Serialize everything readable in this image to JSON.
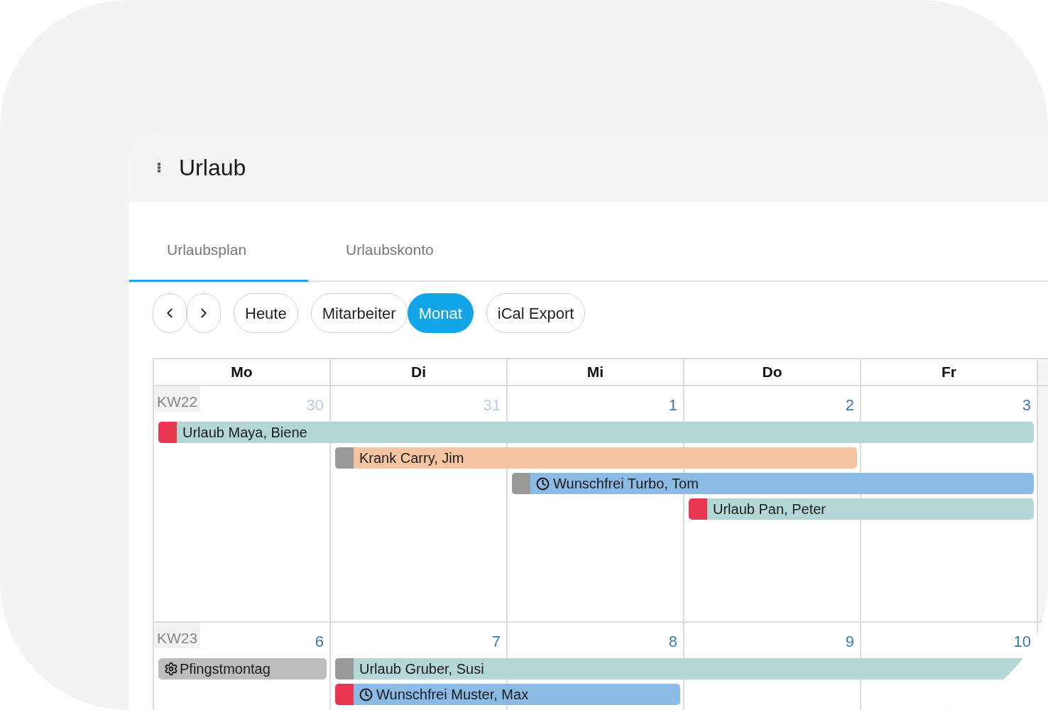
{
  "app": {
    "title": "Urlaub"
  },
  "tabs": [
    {
      "label": "Urlaubsplan",
      "selected": true
    },
    {
      "label": "Urlaubskonto",
      "selected": false
    }
  ],
  "toolbar": {
    "groups": [
      [
        {
          "label": "Heute",
          "selected": false
        }
      ],
      [
        {
          "label": "Mitarbeiter",
          "selected": false
        },
        {
          "label": "Monat",
          "selected": true
        }
      ],
      [
        {
          "label": "iCal Export",
          "selected": false
        }
      ]
    ]
  },
  "calendar": {
    "weekdays": [
      "Mo",
      "Di",
      "Mi",
      "Do",
      "Fr"
    ],
    "weeks": [
      {
        "label": "KW22",
        "days": [
          {
            "number": "30",
            "outside_month": true
          },
          {
            "number": "31",
            "outside_month": true
          },
          {
            "number": "1",
            "outside_month": false
          },
          {
            "number": "2",
            "outside_month": false
          },
          {
            "number": "3",
            "outside_month": false
          }
        ],
        "lanes": [
          [
            {
              "kind": "urlaub",
              "title": "Urlaub Maya, Biene",
              "color": "#e8364f"
            },
            {
              "kind": "continued"
            },
            {
              "kind": "continued"
            },
            {
              "kind": "continued"
            },
            {
              "kind": "continued"
            }
          ],
          [
            {
              "kind": "free"
            },
            {
              "kind": "krank",
              "title": "Krank Carry, Jim",
              "color": "#999999"
            },
            {
              "kind": "continued"
            },
            {
              "kind": "continued"
            },
            {
              "kind": "free"
            }
          ],
          [
            {
              "kind": "free"
            },
            {
              "kind": "free"
            },
            {
              "kind": "wunschfrei",
              "title": "Wunschfrei Turbo, Tom",
              "color": "#999999"
            },
            {
              "kind": "continued"
            },
            {
              "kind": "continued"
            }
          ],
          [
            {
              "kind": "free"
            },
            {
              "kind": "free"
            },
            {
              "kind": "free"
            },
            {
              "kind": "urlaub",
              "title": "Urlaub Pan, Peter",
              "color": "#e8364f"
            },
            {
              "kind": "continued"
            }
          ]
        ]
      },
      {
        "label": "KW23",
        "days": [
          {
            "number": "6",
            "outside_month": false
          },
          {
            "number": "7",
            "outside_month": false
          },
          {
            "number": "8",
            "outside_month": false
          },
          {
            "number": "9",
            "outside_month": false
          },
          {
            "number": "10",
            "outside_month": false
          }
        ],
        "lanes": [
          [
            {
              "kind": "feiertag",
              "title": "Pfingstmontag"
            },
            {
              "kind": "urlaub",
              "title": "Urlaub Gruber, Susi",
              "color": "#999999"
            },
            {
              "kind": "continued"
            },
            {
              "kind": "continued"
            },
            {
              "kind": "continued"
            }
          ],
          [
            {
              "kind": "free"
            },
            {
              "kind": "wunschfrei",
              "title": "Wunschfrei Muster, Max",
              "color": "#e8364f"
            },
            {
              "kind": "continued"
            },
            {
              "kind": "free"
            },
            {
              "kind": "free"
            }
          ]
        ]
      }
    ]
  }
}
